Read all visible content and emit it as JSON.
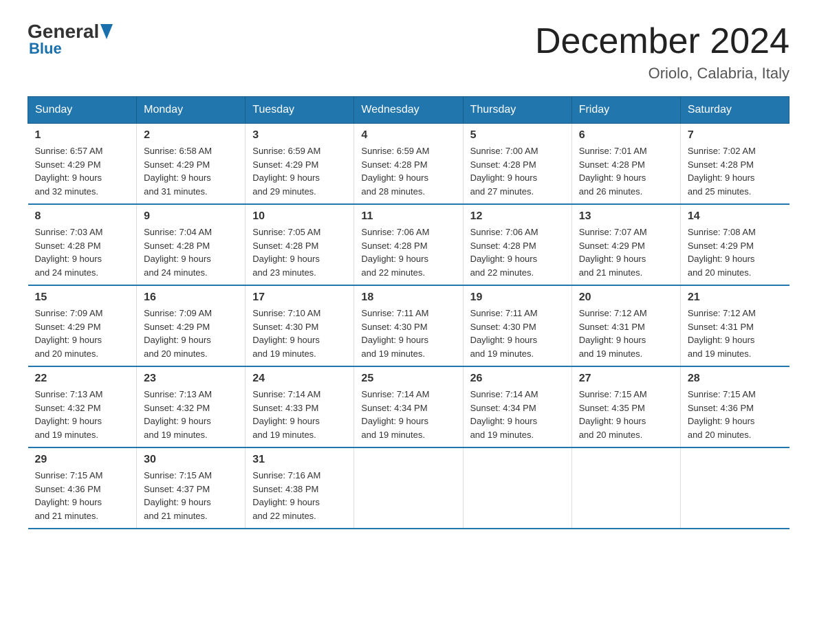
{
  "logo": {
    "general": "General",
    "blue": "Blue"
  },
  "title": "December 2024",
  "subtitle": "Oriolo, Calabria, Italy",
  "days_of_week": [
    "Sunday",
    "Monday",
    "Tuesday",
    "Wednesday",
    "Thursday",
    "Friday",
    "Saturday"
  ],
  "weeks": [
    [
      {
        "day": "1",
        "sunrise": "6:57 AM",
        "sunset": "4:29 PM",
        "daylight": "9 hours and 32 minutes."
      },
      {
        "day": "2",
        "sunrise": "6:58 AM",
        "sunset": "4:29 PM",
        "daylight": "9 hours and 31 minutes."
      },
      {
        "day": "3",
        "sunrise": "6:59 AM",
        "sunset": "4:29 PM",
        "daylight": "9 hours and 29 minutes."
      },
      {
        "day": "4",
        "sunrise": "6:59 AM",
        "sunset": "4:28 PM",
        "daylight": "9 hours and 28 minutes."
      },
      {
        "day": "5",
        "sunrise": "7:00 AM",
        "sunset": "4:28 PM",
        "daylight": "9 hours and 27 minutes."
      },
      {
        "day": "6",
        "sunrise": "7:01 AM",
        "sunset": "4:28 PM",
        "daylight": "9 hours and 26 minutes."
      },
      {
        "day": "7",
        "sunrise": "7:02 AM",
        "sunset": "4:28 PM",
        "daylight": "9 hours and 25 minutes."
      }
    ],
    [
      {
        "day": "8",
        "sunrise": "7:03 AM",
        "sunset": "4:28 PM",
        "daylight": "9 hours and 24 minutes."
      },
      {
        "day": "9",
        "sunrise": "7:04 AM",
        "sunset": "4:28 PM",
        "daylight": "9 hours and 24 minutes."
      },
      {
        "day": "10",
        "sunrise": "7:05 AM",
        "sunset": "4:28 PM",
        "daylight": "9 hours and 23 minutes."
      },
      {
        "day": "11",
        "sunrise": "7:06 AM",
        "sunset": "4:28 PM",
        "daylight": "9 hours and 22 minutes."
      },
      {
        "day": "12",
        "sunrise": "7:06 AM",
        "sunset": "4:28 PM",
        "daylight": "9 hours and 22 minutes."
      },
      {
        "day": "13",
        "sunrise": "7:07 AM",
        "sunset": "4:29 PM",
        "daylight": "9 hours and 21 minutes."
      },
      {
        "day": "14",
        "sunrise": "7:08 AM",
        "sunset": "4:29 PM",
        "daylight": "9 hours and 20 minutes."
      }
    ],
    [
      {
        "day": "15",
        "sunrise": "7:09 AM",
        "sunset": "4:29 PM",
        "daylight": "9 hours and 20 minutes."
      },
      {
        "day": "16",
        "sunrise": "7:09 AM",
        "sunset": "4:29 PM",
        "daylight": "9 hours and 20 minutes."
      },
      {
        "day": "17",
        "sunrise": "7:10 AM",
        "sunset": "4:30 PM",
        "daylight": "9 hours and 19 minutes."
      },
      {
        "day": "18",
        "sunrise": "7:11 AM",
        "sunset": "4:30 PM",
        "daylight": "9 hours and 19 minutes."
      },
      {
        "day": "19",
        "sunrise": "7:11 AM",
        "sunset": "4:30 PM",
        "daylight": "9 hours and 19 minutes."
      },
      {
        "day": "20",
        "sunrise": "7:12 AM",
        "sunset": "4:31 PM",
        "daylight": "9 hours and 19 minutes."
      },
      {
        "day": "21",
        "sunrise": "7:12 AM",
        "sunset": "4:31 PM",
        "daylight": "9 hours and 19 minutes."
      }
    ],
    [
      {
        "day": "22",
        "sunrise": "7:13 AM",
        "sunset": "4:32 PM",
        "daylight": "9 hours and 19 minutes."
      },
      {
        "day": "23",
        "sunrise": "7:13 AM",
        "sunset": "4:32 PM",
        "daylight": "9 hours and 19 minutes."
      },
      {
        "day": "24",
        "sunrise": "7:14 AM",
        "sunset": "4:33 PM",
        "daylight": "9 hours and 19 minutes."
      },
      {
        "day": "25",
        "sunrise": "7:14 AM",
        "sunset": "4:34 PM",
        "daylight": "9 hours and 19 minutes."
      },
      {
        "day": "26",
        "sunrise": "7:14 AM",
        "sunset": "4:34 PM",
        "daylight": "9 hours and 19 minutes."
      },
      {
        "day": "27",
        "sunrise": "7:15 AM",
        "sunset": "4:35 PM",
        "daylight": "9 hours and 20 minutes."
      },
      {
        "day": "28",
        "sunrise": "7:15 AM",
        "sunset": "4:36 PM",
        "daylight": "9 hours and 20 minutes."
      }
    ],
    [
      {
        "day": "29",
        "sunrise": "7:15 AM",
        "sunset": "4:36 PM",
        "daylight": "9 hours and 21 minutes."
      },
      {
        "day": "30",
        "sunrise": "7:15 AM",
        "sunset": "4:37 PM",
        "daylight": "9 hours and 21 minutes."
      },
      {
        "day": "31",
        "sunrise": "7:16 AM",
        "sunset": "4:38 PM",
        "daylight": "9 hours and 22 minutes."
      },
      {
        "day": "",
        "sunrise": "",
        "sunset": "",
        "daylight": ""
      },
      {
        "day": "",
        "sunrise": "",
        "sunset": "",
        "daylight": ""
      },
      {
        "day": "",
        "sunrise": "",
        "sunset": "",
        "daylight": ""
      },
      {
        "day": "",
        "sunrise": "",
        "sunset": "",
        "daylight": ""
      }
    ]
  ]
}
